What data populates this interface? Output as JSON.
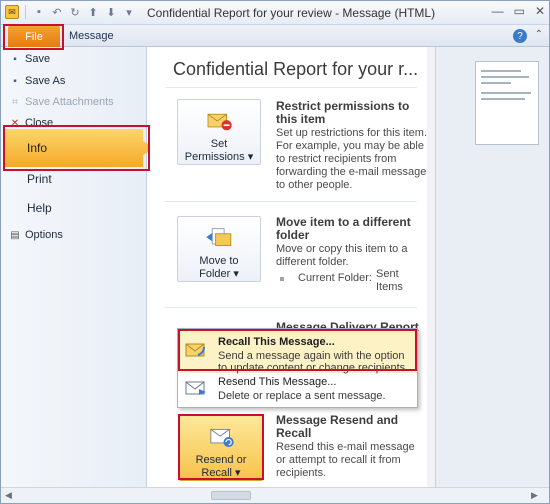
{
  "window": {
    "title": "Confidential Report for your review  -  Message (HTML)"
  },
  "ribbon": {
    "tabs": [
      {
        "label": "File"
      },
      {
        "label": "Message"
      }
    ],
    "help_label": "?"
  },
  "nav": {
    "items": [
      {
        "label": "Save",
        "icon": "save-icon"
      },
      {
        "label": "Save As",
        "icon": "save-as-icon"
      },
      {
        "label": "Save Attachments",
        "icon": "attachment-icon"
      },
      {
        "label": "Close",
        "icon": "close-icon"
      },
      {
        "label": "Info"
      },
      {
        "label": "Print"
      },
      {
        "label": "Help"
      },
      {
        "label": "Options",
        "icon": "options-icon"
      }
    ]
  },
  "main": {
    "title": "Confidential Report for your r...",
    "sections": [
      {
        "button": "Set\nPermissions ▾",
        "title": "Restrict permissions to this item",
        "desc": "Set up restrictions for this item. For example, you may be able to restrict recipients from forwarding the e-mail message to other people."
      },
      {
        "button": "Move to\nFolder ▾",
        "title": "Move item to a different folder",
        "desc": "Move or copy this item to a different folder.",
        "current_folder_label": "Current Folder:",
        "current_folder_value": "Sent Items"
      },
      {
        "title": "Message Delivery Report"
      },
      {
        "button": "Resend or\nRecall ▾",
        "title": "Message Resend and Recall",
        "desc": "Resend this e-mail message or attempt to recall it from recipients."
      }
    ]
  },
  "dropdown": {
    "items": [
      {
        "title": "Recall This Message...",
        "desc_line1": "Send a message again with the option",
        "desc_line2": "to update content or change recipients."
      },
      {
        "title": "Resend This Message...",
        "desc_line1": "Delete or replace a sent message."
      }
    ]
  },
  "colors": {
    "accent_orange": "#f6a828",
    "highlight_red": "#c8102e",
    "file_tab": "#e47b12"
  }
}
